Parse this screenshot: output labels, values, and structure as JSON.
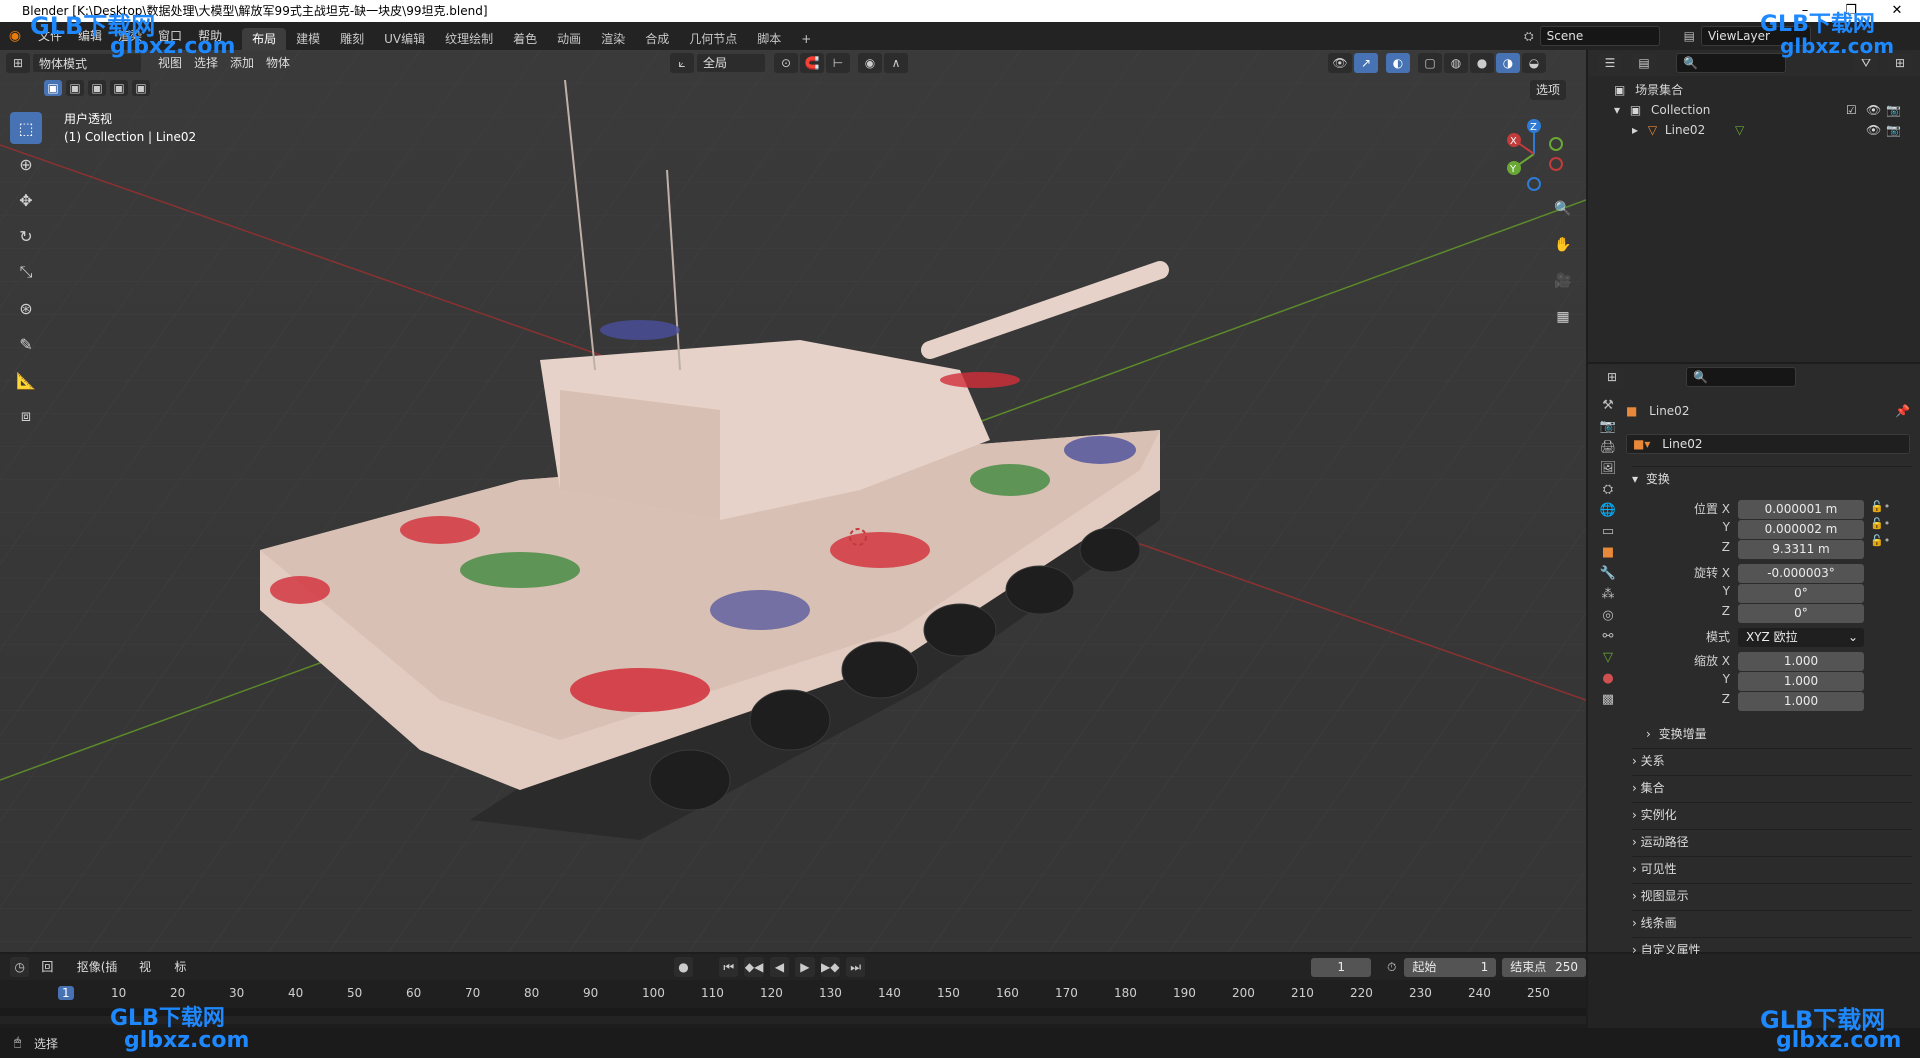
{
  "window": {
    "title": "Blender [K:\\Desktop\\数据处理\\大模型\\解放军99式主战坦克-缺一块皮\\99坦克.blend]",
    "controls": [
      "–",
      "❐",
      "✕"
    ]
  },
  "menu": [
    "文件",
    "编辑",
    "渲染",
    "窗口",
    "帮助"
  ],
  "workspaces": [
    "布局",
    "建模",
    "雕刻",
    "UV编辑",
    "纹理绘制",
    "着色",
    "动画",
    "渲染",
    "合成",
    "几何节点",
    "脚本"
  ],
  "active_workspace": "布局",
  "scene": {
    "name": "Scene",
    "view_layer": "ViewLayer"
  },
  "viewport": {
    "mode": "物体模式",
    "menus": [
      "视图",
      "选择",
      "添加",
      "物体"
    ],
    "transform_orientation": "全局",
    "options": "选项",
    "view_name": "用户透视",
    "collection_line": "(1) Collection | Line02",
    "gizmo": {
      "x": "X",
      "y": "Y",
      "z": "Z"
    }
  },
  "outliner": {
    "root": "场景集合",
    "collection": "Collection",
    "object": "Line02"
  },
  "properties": {
    "object_name": "Line02",
    "data_name": "Line02",
    "transform_title": "变换",
    "location_label": "位置 X",
    "rotation_label": "旋转 X",
    "scale_label": "缩放 X",
    "location": [
      "0.000001 m",
      "0.000002 m",
      "9.3311 m"
    ],
    "rotation": [
      "-0.000003°",
      "0°",
      "0°"
    ],
    "mode_label": "模式",
    "mode_value": "XYZ 欧拉",
    "scale": [
      "1.000",
      "1.000",
      "1.000"
    ],
    "axis_y": "Y",
    "axis_z": "Z",
    "delta": "变换增量",
    "panels": [
      "关系",
      "集合",
      "实例化",
      "运动路径",
      "可见性",
      "视图显示",
      "线条画",
      "自定义属性"
    ]
  },
  "timeline": {
    "menus": [
      "回放",
      "抠像(插帧)",
      "视图",
      "标记"
    ],
    "current_frame": "1",
    "start_label": "起始",
    "start": "1",
    "end_label": "结束点",
    "end": "250",
    "ticks": [
      "1",
      "10",
      "20",
      "30",
      "40",
      "50",
      "60",
      "70",
      "80",
      "90",
      "100",
      "110",
      "120",
      "130",
      "140",
      "150",
      "160",
      "170",
      "180",
      "190",
      "200",
      "210",
      "220",
      "230",
      "240",
      "250"
    ]
  },
  "status": {
    "left": "选择"
  },
  "watermark": {
    "brand": "GLB下载网",
    "url": "glbxz.com"
  },
  "colors": {
    "accent": "#4772b3",
    "x_axis": "#c23b3b",
    "y_axis": "#6aa835",
    "z_axis": "#2f7ad4"
  }
}
